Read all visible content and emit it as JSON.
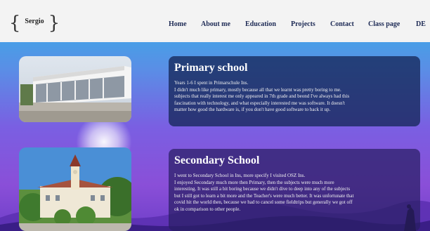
{
  "header": {
    "logo_text": "Sergio",
    "logo_sub": "—",
    "nav": [
      {
        "label": "Home"
      },
      {
        "label": "About me"
      },
      {
        "label": "Education"
      },
      {
        "label": "Projects"
      },
      {
        "label": "Contact"
      },
      {
        "label": "Class page"
      },
      {
        "label": "DE"
      }
    ]
  },
  "sections": [
    {
      "title": "Primary school",
      "lines": [
        "Years 1-6 I spent in Primarschule Ins.",
        "I didn't much like primary, mostly because all that we learnt was pretty boring to me.",
        "subjects that really interest me only appeared in 7th grade and beond I've always had this",
        "fascination with technology, and what especially interested me was software. It doesn't",
        "matter how good the hardware is, if you don't have good software to back it up."
      ]
    },
    {
      "title": "Secondary School",
      "lines": [
        "I went to Secondary School in Ins, more specify I visited OSZ Ins.",
        "I enjoyed Secondary much more then Primary, then the subjects were much more",
        "interesting. It was still a bit boring because we didn't dive to deep into any of the subjects",
        "but I still got to learn a bit more and the Teacher's were much better. It was unfortunate that",
        "covid hit the world then, because we had to cancel some fieldtrips but generally we got off",
        "ok in comparison to other people."
      ]
    }
  ],
  "colors": {
    "header_bg": "#f3f3f3",
    "nav_text": "#1d2a55",
    "card_bg": "#16285a"
  }
}
